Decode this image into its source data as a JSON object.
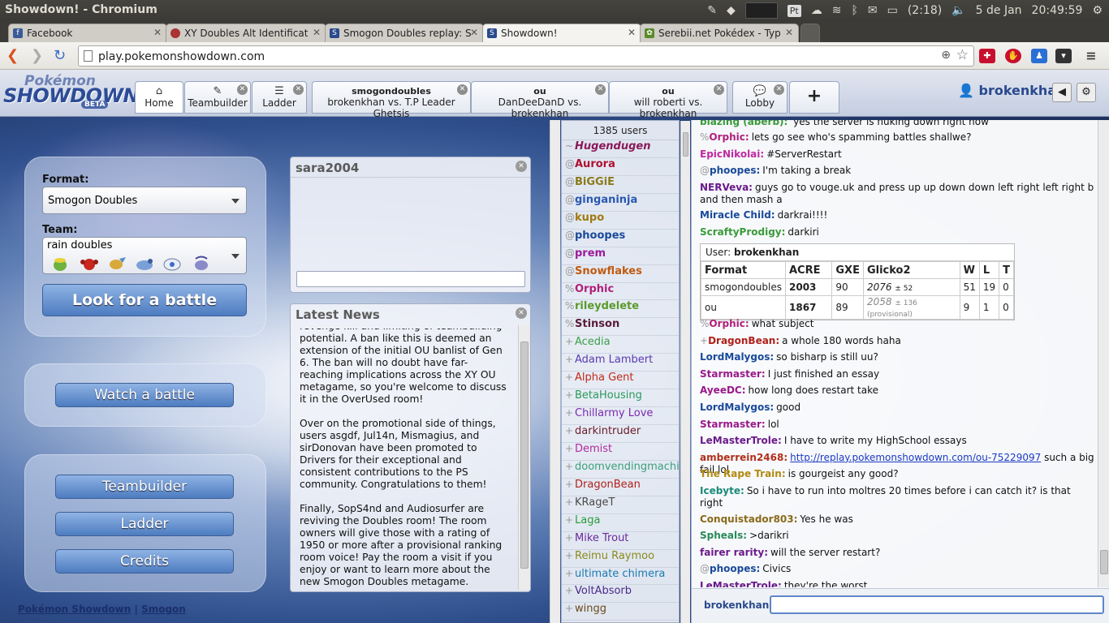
{
  "os": {
    "window_title": "Showdown! - Chromium",
    "battery": "(2:18)",
    "date": "5 de Jan",
    "time": "20:49:59",
    "keyboard_indicator": "Pt"
  },
  "browser": {
    "tabs": [
      {
        "label": "Facebook",
        "icon": "facebook-icon",
        "color": "#3b5998"
      },
      {
        "label": "XY Doubles Alt Identificat",
        "icon": "pokeball-icon",
        "color": "#a33"
      },
      {
        "label": "Smogon Doubles replay: S",
        "icon": "showdown-icon",
        "color": "#2a4a8e"
      },
      {
        "label": "Showdown!",
        "icon": "showdown-icon",
        "color": "#2a4a8e"
      },
      {
        "label": "Serebii.net Pokédex - Typ",
        "icon": "serebii-icon",
        "color": "#5a8a2a"
      }
    ],
    "url": "play.pokemonshowdown.com"
  },
  "ps": {
    "logo": {
      "top": "Pokémon",
      "main": "SHOWDOWN!",
      "badge": "BETA"
    },
    "tabs": {
      "home": "Home",
      "teambuilder": "Teambuilder",
      "ladder": "Ladder",
      "battle1": {
        "format": "smogondoubles",
        "vs": "brokenkhan vs. T.P Leader Ghetsis"
      },
      "battle2": {
        "format": "ou",
        "vs": "DanDeeDanD vs. brokenkhan"
      },
      "battle3": {
        "format": "ou",
        "vs": "will roberti vs. brokenkhan"
      },
      "lobby": "Lobby",
      "add": "+"
    },
    "username": "brokenkhan"
  },
  "menu": {
    "format_label": "Format:",
    "format_value": "Smogon Doubles",
    "team_label": "Team:",
    "team_value": "rain doubles",
    "team_pokemon": [
      "ludicolo-icon",
      "scizor-icon",
      "kingdra-icon",
      "politoed-icon",
      "rotom-icon",
      "thundurus-icon"
    ],
    "search_button": "Look for a battle",
    "watch_button": "Watch a battle",
    "teambuilder_button": "Teambuilder",
    "ladder_button": "Ladder",
    "credits_button": "Credits",
    "footer_link1": "Pokémon Showdown",
    "footer_sep": "|",
    "footer_link2": "Smogon"
  },
  "pm": {
    "title": "sara2004"
  },
  "news": {
    "title": "Latest News",
    "paragraphs": [
      "revenge kill and limiting of teambuilding potential. A ban like this is deemed an extension of the initial OU banlist of Gen 6. The ban will no doubt have far-reaching implications across the XY OU metagame, so you're welcome to discuss it in the OverUsed room!",
      "Over on the promotional side of things, users asgdf, Jul14n, Mismagius, and sirDonovan have been promoted to Drivers for their exceptional and consistent contributions to the PS community. Congratulations to them!",
      "Finally, SopS4nd and Audiosurfer are reviving the Doubles room! The room owners will give those with a rating of 1950 or more after a provisional ranking room voice! Pay the room a visit if you enjoy or want to learn more about the new Smogon Doubles metagame."
    ]
  },
  "userlist": {
    "count": "1385 users",
    "users": [
      {
        "rank": "~",
        "name": "Hugendugen",
        "color": "#8a1a5a",
        "bold": true,
        "italic": true
      },
      {
        "rank": "@",
        "name": "Aurora",
        "color": "#b01030",
        "bold": true
      },
      {
        "rank": "@",
        "name": "BiGGiE",
        "color": "#8a7a1a",
        "bold": true
      },
      {
        "rank": "@",
        "name": "ginganinja",
        "color": "#2a58b0",
        "bold": true
      },
      {
        "rank": "@",
        "name": "kupo",
        "color": "#a07a10",
        "bold": true
      },
      {
        "rank": "@",
        "name": "phoopes",
        "color": "#1a4a9a",
        "bold": true
      },
      {
        "rank": "@",
        "name": "prem",
        "color": "#9a1a9a",
        "bold": true
      },
      {
        "rank": "@",
        "name": "Snowflakes",
        "color": "#c05a10",
        "bold": true
      },
      {
        "rank": "%",
        "name": "Orphic",
        "color": "#b0207a",
        "bold": true
      },
      {
        "rank": "%",
        "name": "rileydelete",
        "color": "#5a9a2a",
        "bold": true
      },
      {
        "rank": "%",
        "name": "Stinson",
        "color": "#5a1a3a",
        "bold": true
      },
      {
        "rank": "+",
        "name": "Acedia",
        "color": "#3aa04a",
        "bold": false
      },
      {
        "rank": "+",
        "name": "Adam Lambert",
        "color": "#5a3ab0",
        "bold": false
      },
      {
        "rank": "+",
        "name": "Alpha Gent",
        "color": "#c02a1a",
        "bold": false
      },
      {
        "rank": "+",
        "name": "BetaHousing",
        "color": "#2a9a5a",
        "bold": false
      },
      {
        "rank": "+",
        "name": "Chillarmy Love",
        "color": "#7a2ab0",
        "bold": false
      },
      {
        "rank": "+",
        "name": "darkintruder",
        "color": "#6a1a2a",
        "bold": false
      },
      {
        "rank": "+",
        "name": "Demist",
        "color": "#b02aa0",
        "bold": false
      },
      {
        "rank": "+",
        "name": "doomvendingmachine",
        "color": "#3aa07a",
        "bold": false
      },
      {
        "rank": "+",
        "name": "DragonBean",
        "color": "#b0201a",
        "bold": false
      },
      {
        "rank": "+",
        "name": "KRageT",
        "color": "#4a4a4a",
        "bold": false
      },
      {
        "rank": "+",
        "name": "Laga",
        "color": "#2a9a3a",
        "bold": false
      },
      {
        "rank": "+",
        "name": "Mike Trout",
        "color": "#6a2a9a",
        "bold": false
      },
      {
        "rank": "+",
        "name": "Reimu Raymoo",
        "color": "#8a8a1a",
        "bold": false
      },
      {
        "rank": "+",
        "name": "ultimate chimera",
        "color": "#1a7ab0",
        "bold": false
      },
      {
        "rank": "+",
        "name": "VoltAbsorb",
        "color": "#4a2a8a",
        "bold": false
      },
      {
        "rank": "+",
        "name": "wingg",
        "color": "#6a4a1a",
        "bold": false
      }
    ]
  },
  "chat": {
    "partial_line": {
      "name": "blazing (aberb):",
      "text": "yes the server is nuking down right now",
      "color": "#3a9a3a"
    },
    "lines_top": [
      {
        "rank": "%",
        "name": "Orphic:",
        "text": "lets go see who's spamming battles shallwe?",
        "color": "#b0207a"
      },
      {
        "rank": "",
        "name": "EpicNikolai:",
        "text": "#ServerRestart",
        "color": "#c02aa0"
      },
      {
        "rank": "@",
        "name": "phoopes:",
        "text": "I'm taking a break",
        "color": "#1a4a9a"
      },
      {
        "rank": "",
        "name": "NERVeva:",
        "text": "guys go to vouge.uk and press up up down down left right left right b and then mash a",
        "color": "#6a1a8a"
      },
      {
        "rank": "",
        "name": "Miracle Child:",
        "text": "darkrai!!!!",
        "color": "#1a4a9a"
      },
      {
        "rank": "",
        "name": "ScraftyProdigy:",
        "text": "darkiri",
        "color": "#3a9a3a"
      }
    ],
    "stats": {
      "user_label": "User:",
      "user": "brokenkhan",
      "headers": [
        "Format",
        "ACRE",
        "GXE",
        "Glicko2",
        "W",
        "L",
        "T"
      ],
      "rows": [
        {
          "format": "smogondoubles",
          "acre": "2003",
          "gxe": "90",
          "glicko": "2076",
          "dev": "± 52",
          "prov": "",
          "w": "51",
          "l": "19",
          "t": "0"
        },
        {
          "format": "ou",
          "acre": "1867",
          "gxe": "89",
          "glicko": "2058",
          "dev": "± 136",
          "prov": "(provisional)",
          "w": "9",
          "l": "1",
          "t": "0"
        }
      ]
    },
    "lines_bottom": [
      {
        "rank": "%",
        "name": "Orphic:",
        "text": "what subject",
        "color": "#b0207a"
      },
      {
        "rank": "+",
        "name": "DragonBean:",
        "text": "a whole 180 words haha",
        "color": "#b0201a"
      },
      {
        "rank": "",
        "name": "LordMalygos:",
        "text": "so bisharp is still uu?",
        "color": "#1a4a9a"
      },
      {
        "rank": "",
        "name": "Starmaster:",
        "text": "I just finished an essay",
        "color": "#9a1a8a"
      },
      {
        "rank": "",
        "name": "AyeeDC:",
        "text": "how long does restart take",
        "color": "#9a1a8a"
      },
      {
        "rank": "",
        "name": "LordMalygos:",
        "text": "good",
        "color": "#1a4a9a"
      },
      {
        "rank": "",
        "name": "Starmaster:",
        "text": "lol",
        "color": "#9a1a8a"
      },
      {
        "rank": "",
        "name": "LeMasterTrole:",
        "text": "I have to write my HighSchool essays",
        "color": "#6a1a8a"
      },
      {
        "rank": "",
        "name": "amberrein2468:",
        "link": "http://replay.pokemonshowdown.com/ou-75229097",
        "text": "such a big fail lol",
        "color": "#b0301a"
      },
      {
        "rank": "",
        "name": "The Rape Train:",
        "text": "is gourgeist any good?",
        "color": "#b08a10"
      },
      {
        "rank": "",
        "name": "Icebyte:",
        "text": "So i have to run into moltres 20 times before i can catch it? is that right",
        "color": "#1a8a7a"
      },
      {
        "rank": "",
        "name": "Conquistador803:",
        "text": "Yes he was",
        "color": "#8a6a1a"
      },
      {
        "rank": "",
        "name": "Spheals:",
        "text": ">darikri",
        "color": "#2a8a5a"
      },
      {
        "rank": "",
        "name": "fairer rarity:",
        "text": "will the server restart?",
        "color": "#6a1a8a"
      },
      {
        "rank": "@",
        "name": "phoopes:",
        "text": "Civics",
        "color": "#1a4a9a"
      },
      {
        "rank": "",
        "name": "LeMasterTrole:",
        "text": "they're the worst",
        "color": "#6a1a8a"
      }
    ],
    "input_user": "brokenkhan:",
    "input_value": ""
  }
}
